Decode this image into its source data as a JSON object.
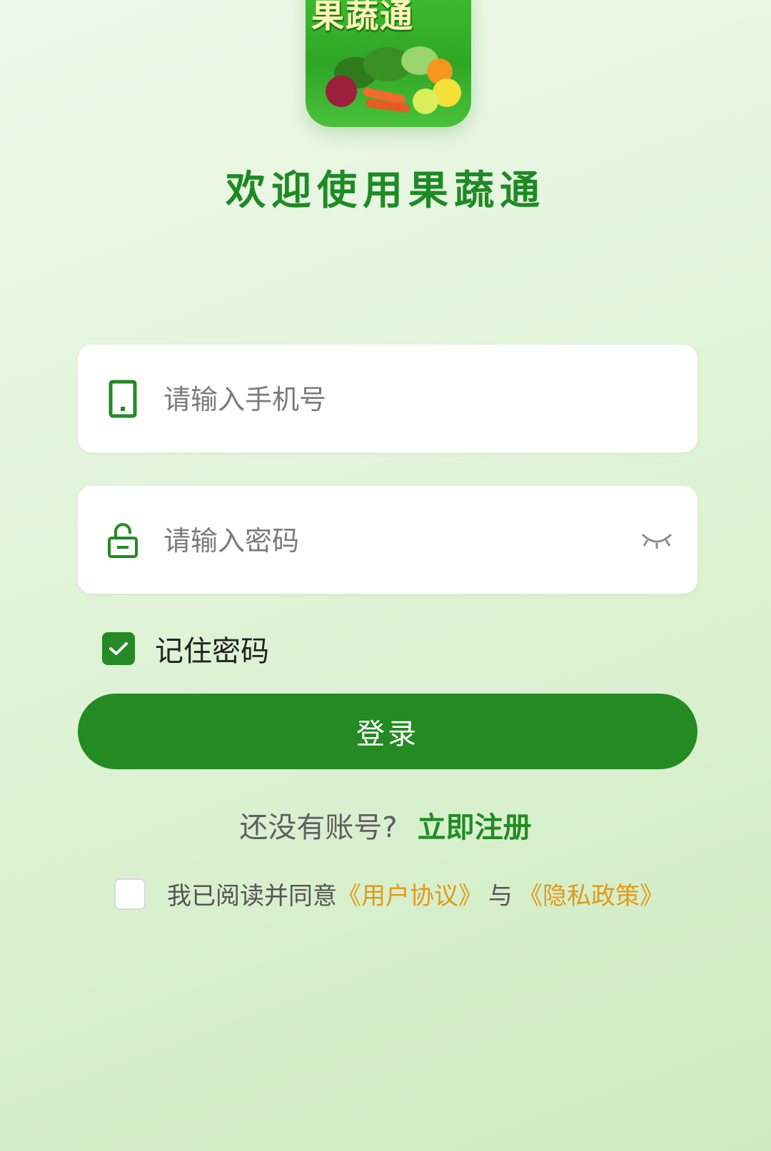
{
  "app": {
    "logo_text": "果蔬通",
    "welcome_title": "欢迎使用果蔬通"
  },
  "login_form": {
    "phone_placeholder": "请输入手机号",
    "password_placeholder": "请输入密码",
    "remember_password_label": "记住密码",
    "remember_password_checked": true,
    "login_button_label": "登录"
  },
  "register": {
    "prompt": "还没有账号?",
    "link_label": "立即注册"
  },
  "agreement": {
    "checked": false,
    "prefix": "我已阅读并同意",
    "user_agreement_label": "《用户协议》",
    "separator": "与",
    "privacy_policy_label": "《隐私政策》"
  },
  "colors": {
    "brand_green": "#248a22",
    "link_orange": "#e39a17"
  },
  "icons": {
    "phone": "phone-icon",
    "lock": "lock-icon",
    "eye_closed": "eye-closed-icon",
    "check": "check-icon"
  }
}
